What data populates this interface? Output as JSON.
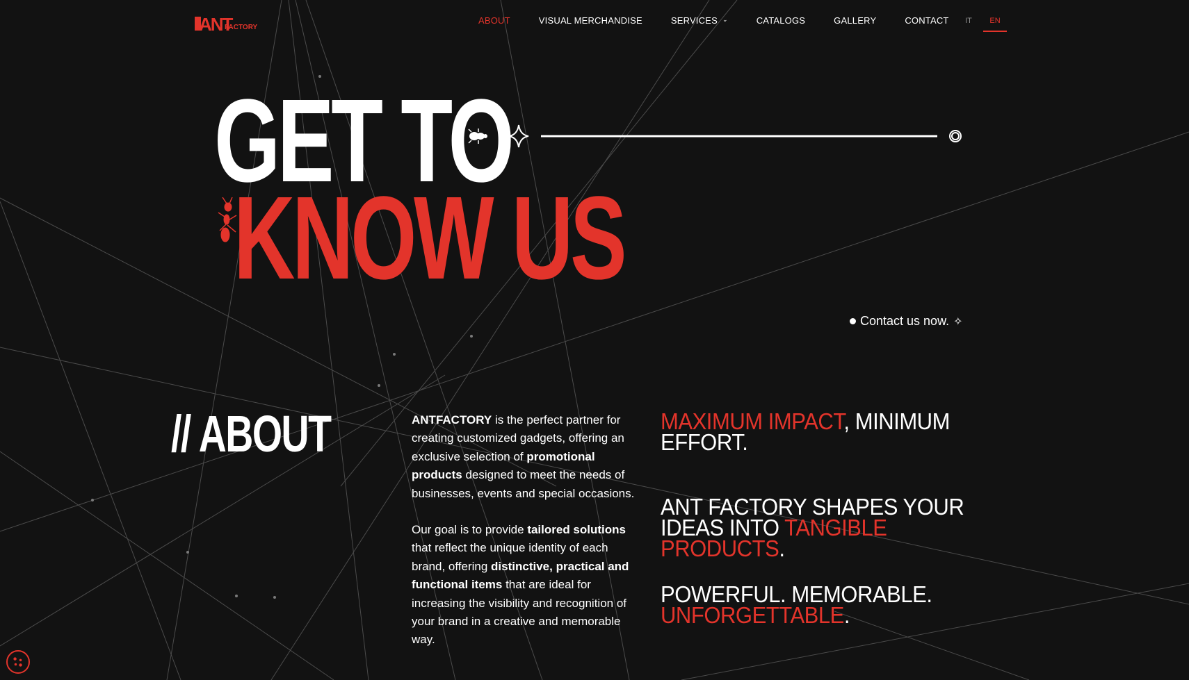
{
  "brand": {
    "logo_text_big": "ANT",
    "logo_text_small": "FACTORY",
    "accent": "#e3342b",
    "background": "#121212"
  },
  "nav": {
    "items": [
      {
        "label": "ABOUT",
        "active": true
      },
      {
        "label": "VISUAL MERCHANDISE"
      },
      {
        "label": "SERVICES",
        "has_dropdown": true
      },
      {
        "label": "CATALOGS"
      },
      {
        "label": "GALLERY"
      },
      {
        "label": "CONTACT"
      }
    ],
    "languages": [
      {
        "label": "IT"
      },
      {
        "label": "EN",
        "active": true
      }
    ]
  },
  "hero": {
    "line1": "GET TO",
    "line2": "KNOW US",
    "cta": "Contact us now.",
    "icons": [
      "beetle-icon",
      "sparkle-icon",
      "ring-icon",
      "ant-icon"
    ]
  },
  "about": {
    "title": "// ABOUT",
    "para1": [
      {
        "b": true,
        "t": "ANTFACTORY"
      },
      {
        "t": " is the perfect partner for creating customized gadgets, offering an exclusive selection of "
      },
      {
        "b": true,
        "t": "promotional products"
      },
      {
        "t": " designed to meet the needs of businesses, events and special occasions."
      }
    ],
    "para2": [
      {
        "t": "Our goal is to provide "
      },
      {
        "b": true,
        "t": "tailored solutions"
      },
      {
        "t": " that reflect the unique identity of each brand, offering "
      },
      {
        "b": true,
        "t": "distinctive, practical and functional items"
      },
      {
        "t": " that are ideal for increasing the visibility and recognition of your brand in a creative and memorable way."
      }
    ]
  },
  "claims": {
    "c1_red": "MAXIMUM IMPACT",
    "c1_white": ", MINIMUM EFFORT.",
    "c2_white": "ANT FACTORY SHAPES YOUR IDEAS INTO ",
    "c2_red": "TANGIBLE PRODUCTS",
    "c2_end": ".",
    "c3_white": "POWERFUL. MEMORABLE. ",
    "c3_red": "UNFORGETTABLE",
    "c3_end": "."
  },
  "cookie": {
    "icon": "cookie-icon"
  }
}
